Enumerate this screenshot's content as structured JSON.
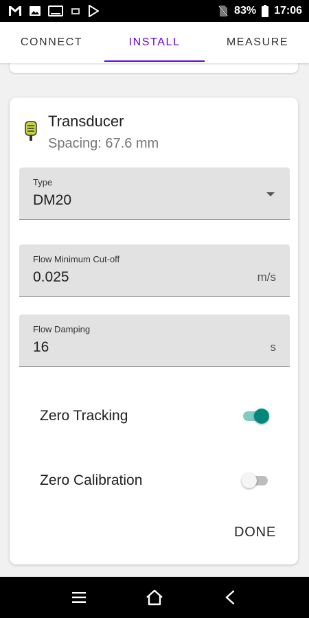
{
  "status_bar": {
    "battery": "83%",
    "time": "17:06",
    "icons": [
      "gmail-icon",
      "image-icon",
      "cast-icon",
      "sim-icon",
      "play-store-icon",
      "no-sim-icon",
      "battery-icon"
    ]
  },
  "tabs": [
    {
      "label": "CONNECT",
      "active": false
    },
    {
      "label": "INSTALL",
      "active": true
    },
    {
      "label": "MEASURE",
      "active": false
    }
  ],
  "card": {
    "title": "Transducer",
    "subtitle": "Spacing: 67.6 mm",
    "icon": "transducer-icon",
    "fields": {
      "type": {
        "label": "Type",
        "value": "DM20"
      },
      "flow_min_cutoff": {
        "label": "Flow Minimum Cut-off",
        "value": "0.025",
        "suffix": "m/s"
      },
      "flow_damping": {
        "label": "Flow Damping",
        "value": "16",
        "suffix": "s"
      }
    },
    "switches": {
      "zero_tracking": {
        "label": "Zero Tracking",
        "on": true
      },
      "zero_calibration": {
        "label": "Zero Calibration",
        "on": false
      }
    },
    "done_label": "DONE"
  },
  "colors": {
    "accent": "#6200ee",
    "switch_on": "#00897b",
    "transducer_icon": "#c6d63a"
  },
  "nav_bar": {
    "icons": [
      "menu-icon",
      "home-icon",
      "back-icon"
    ]
  }
}
